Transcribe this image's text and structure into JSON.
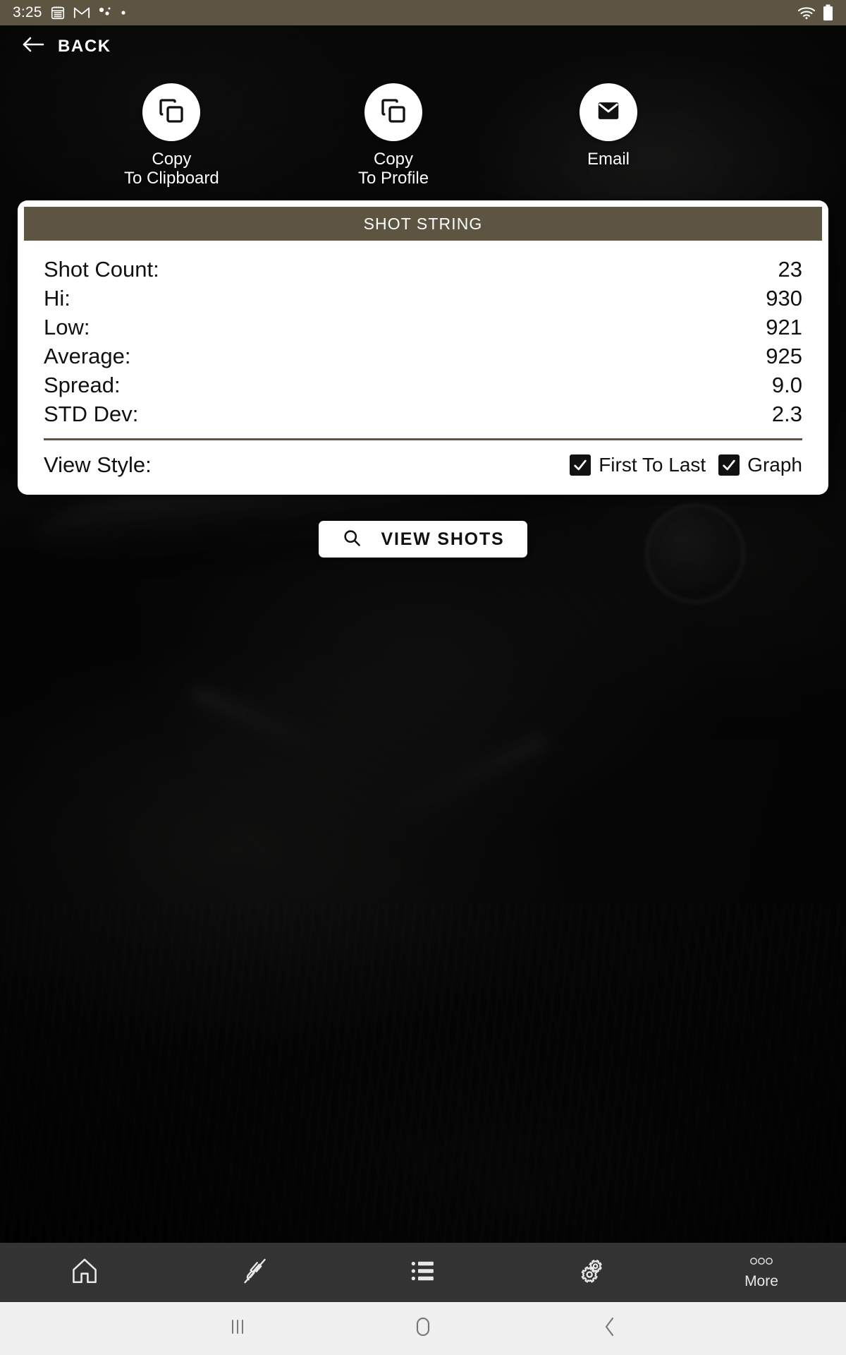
{
  "status_bar": {
    "time": "3:25",
    "left_icons": [
      "calendar-icon",
      "gmail-icon",
      "dots-icon",
      "dot-icon"
    ],
    "right_icons": [
      "wifi-icon",
      "battery-icon"
    ],
    "background_color": "#5d5441"
  },
  "header": {
    "back_label": "BACK",
    "back_icon": "arrow-left-icon"
  },
  "actions": [
    {
      "icon": "copy-icon",
      "label_line1": "Copy",
      "label_line2": "To Clipboard"
    },
    {
      "icon": "copy-icon",
      "label_line1": "Copy",
      "label_line2": "To Profile"
    },
    {
      "icon": "email-icon",
      "label_line1": "Email",
      "label_line2": ""
    }
  ],
  "card": {
    "title": "SHOT STRING",
    "accent_color": "#5d5441",
    "stats": [
      {
        "label": "Shot Count:",
        "value": "23"
      },
      {
        "label": "Hi:",
        "value": "930"
      },
      {
        "label": "Low:",
        "value": "921"
      },
      {
        "label": "Average:",
        "value": "925"
      },
      {
        "label": "Spread:",
        "value": "9.0"
      },
      {
        "label": "STD Dev:",
        "value": "2.3"
      }
    ],
    "view_style": {
      "label": "View Style:",
      "options": [
        {
          "label": "First To Last",
          "checked": true
        },
        {
          "label": "Graph",
          "checked": true
        }
      ]
    }
  },
  "view_shots_button": {
    "label": "VIEW SHOTS",
    "icon": "search-icon"
  },
  "app_nav": [
    {
      "icon": "home-icon",
      "label": ""
    },
    {
      "icon": "rifle-icon",
      "label": ""
    },
    {
      "icon": "list-icon",
      "label": ""
    },
    {
      "icon": "gears-icon",
      "label": ""
    },
    {
      "icon": "ellipsis-icon",
      "label": "More"
    }
  ],
  "system_nav": {
    "recents_icon": "recents-icon",
    "home_icon": "home-circle-icon",
    "back_icon": "chevron-left-icon"
  }
}
